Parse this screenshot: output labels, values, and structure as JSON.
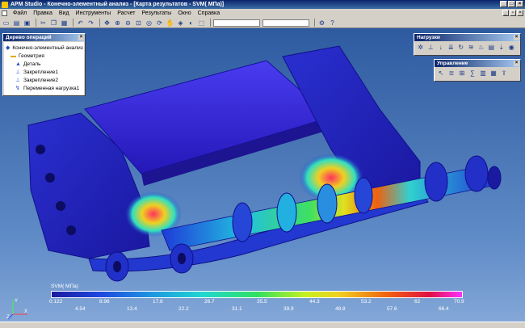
{
  "window": {
    "title": "APM Studio - Конечно-элементный анализ - [Карта результатов - SVM( МПа)]"
  },
  "menu": [
    "Файл",
    "Правка",
    "Вид",
    "Инструменты",
    "Расчет",
    "Результаты",
    "Окно",
    "Справка"
  ],
  "icons": {
    "new": "new-file-icon",
    "open": "open-folder-icon",
    "save": "save-icon",
    "move": "move-icon",
    "zoom": "zoom-icon",
    "rotate": "rotate-icon"
  },
  "tree": {
    "title": "Дерево операций",
    "items": [
      {
        "label": "Конечно-элементный анализ",
        "icon": "fea-root-icon"
      },
      {
        "label": "Геометрия",
        "icon": "folder-icon"
      },
      {
        "label": "Деталь",
        "icon": "part-icon"
      },
      {
        "label": "Закрепление1",
        "icon": "constraint-icon"
      },
      {
        "label": "Закрепление2",
        "icon": "constraint-icon"
      },
      {
        "label": "Переменная нагрузка1",
        "icon": "load-icon"
      }
    ]
  },
  "loads_panel": {
    "title": "Нагрузки"
  },
  "control_panel": {
    "title": "Управление"
  },
  "legend": {
    "title": "SVM( МПа)",
    "top_ticks": [
      "0.122",
      "8.96",
      "17.8",
      "26.7",
      "35.5",
      "44.3",
      "53.2",
      "62",
      "70.9"
    ],
    "bottom_ticks": [
      "4.54",
      "13.4",
      "22.2",
      "31.1",
      "39.9",
      "48.8",
      "57.6",
      "66.4"
    ],
    "colors": [
      "#1a1aa0",
      "#1e48e0",
      "#1e9ae0",
      "#20d8d0",
      "#30e060",
      "#c8f020",
      "#f0d020",
      "#f06010",
      "#e01040",
      "#ff30ff"
    ]
  },
  "axes": {
    "x": "X",
    "y": "Y",
    "z": "Z"
  }
}
